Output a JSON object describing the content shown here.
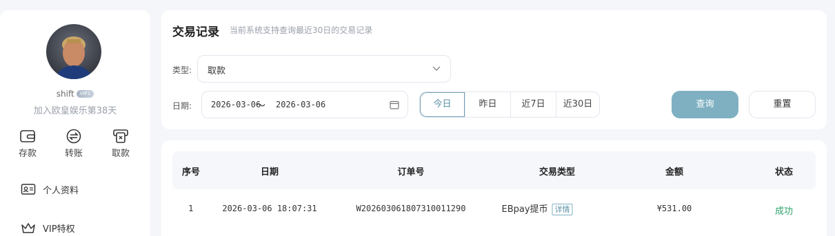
{
  "sidebar": {
    "username": "shift",
    "vip_badge": "VIP1",
    "join_text": "加入欧皇娱乐第38天",
    "quick_actions": [
      {
        "label": "存款",
        "icon": "wallet-icon"
      },
      {
        "label": "转账",
        "icon": "transfer-icon"
      },
      {
        "label": "取款",
        "icon": "withdraw-icon"
      }
    ],
    "nav": [
      {
        "label": "个人资料",
        "icon": "id-card-icon"
      },
      {
        "label": "VIP特权",
        "icon": "crown-icon"
      }
    ]
  },
  "filter": {
    "title": "交易记录",
    "subtitle": "当前系统支持查询最近30日的交易记录",
    "type_label": "类型:",
    "type_value": "取款",
    "date_label": "日期:",
    "date_start": "2026-03-06",
    "date_sep": "〜",
    "date_end": "2026-03-06",
    "ranges": [
      "今日",
      "昨日",
      "近7日",
      "近30日"
    ],
    "active_range": "今日",
    "query_label": "查询",
    "reset_label": "重置"
  },
  "table": {
    "headers": [
      "序号",
      "日期",
      "订单号",
      "交易类型",
      "金额",
      "状态"
    ],
    "rows": [
      {
        "index": "1",
        "date": "2026-03-06 18:07:31",
        "order_no": "W20260306180731001129​0",
        "type": "EBpay提币",
        "detail_label": "详情",
        "amount": "¥531.00",
        "status": "成功"
      }
    ]
  },
  "colors": {
    "accent": "#7fb0c2",
    "success": "#2fa36b",
    "page_bg": "#f5f6fa"
  }
}
